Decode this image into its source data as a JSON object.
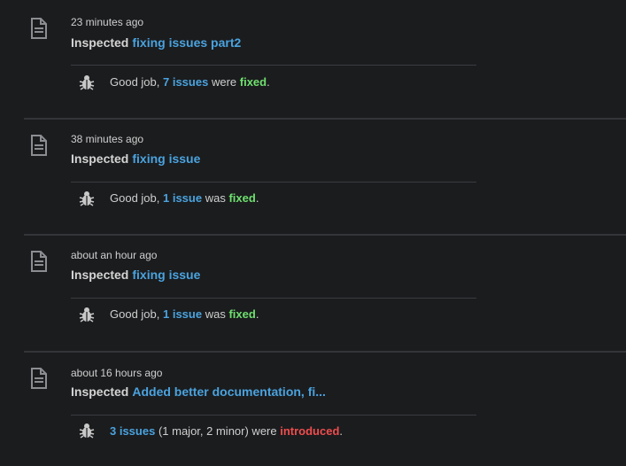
{
  "entries": [
    {
      "time": "23 minutes ago",
      "prefix": "Inspected",
      "link": "fixing issues part2",
      "detail_pre": "Good job,",
      "detail_num": "7 issues",
      "detail_mid": "were",
      "detail_status": "fixed",
      "detail_end": "."
    },
    {
      "time": "38 minutes ago",
      "prefix": "Inspected",
      "link": "fixing issue",
      "detail_pre": "Good job,",
      "detail_num": "1 issue",
      "detail_mid": "was",
      "detail_status": "fixed",
      "detail_end": "."
    },
    {
      "time": "about an hour ago",
      "prefix": "Inspected",
      "link": "fixing issue",
      "detail_pre": "Good job,",
      "detail_num": "1 issue",
      "detail_mid": "was",
      "detail_status": "fixed",
      "detail_end": "."
    },
    {
      "time": "about 16 hours ago",
      "prefix": "Inspected",
      "link": "Added better documentation, fi...",
      "detail_num": "3 issues",
      "detail_mid": "(1 major, 2 minor) were",
      "detail_status": "introduced",
      "detail_end": "."
    }
  ],
  "icons": {
    "entry_icon": "document-icon",
    "detail_icon": "bug-icon"
  },
  "colors": {
    "background": "#1b1c1e",
    "link": "#4aa3df",
    "fixed": "#6ee06e",
    "introduced": "#ef4d4d"
  }
}
